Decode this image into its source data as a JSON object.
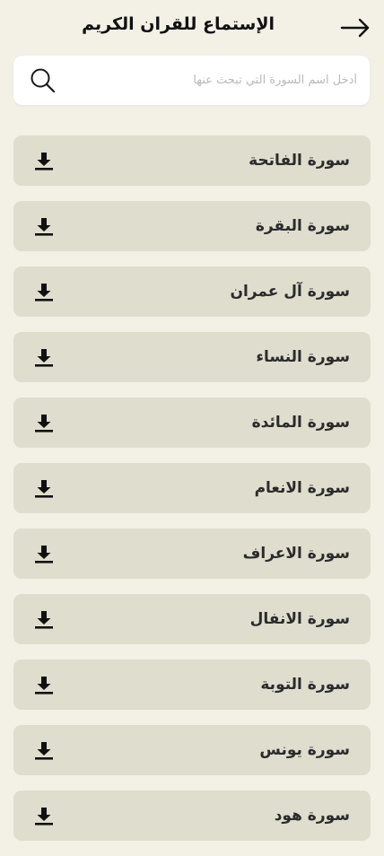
{
  "header": {
    "title": "الإستماع للقران الكريم",
    "back_icon": "arrow-right-icon"
  },
  "search": {
    "placeholder": "أدخل اسم السورة التي تبحث عنها",
    "value": "",
    "icon": "search-icon"
  },
  "surahs": [
    {
      "name": "سورة الفاتحة",
      "icon": "download-icon"
    },
    {
      "name": "سورة البقرة",
      "icon": "download-icon"
    },
    {
      "name": "سورة آل عمران",
      "icon": "download-icon"
    },
    {
      "name": "سورة النساء",
      "icon": "download-icon"
    },
    {
      "name": "سورة المائدة",
      "icon": "download-icon"
    },
    {
      "name": "سورة الانعام",
      "icon": "download-icon"
    },
    {
      "name": "سورة الاعراف",
      "icon": "download-icon"
    },
    {
      "name": "سورة الانفال",
      "icon": "download-icon"
    },
    {
      "name": "سورة التوبة",
      "icon": "download-icon"
    },
    {
      "name": "سورة يونس",
      "icon": "download-icon"
    },
    {
      "name": "سورة هود",
      "icon": "download-icon"
    }
  ],
  "colors": {
    "background": "#f3f1e6",
    "card": "#deddce",
    "text": "#2b2b2b",
    "search_bg": "#ffffff"
  }
}
